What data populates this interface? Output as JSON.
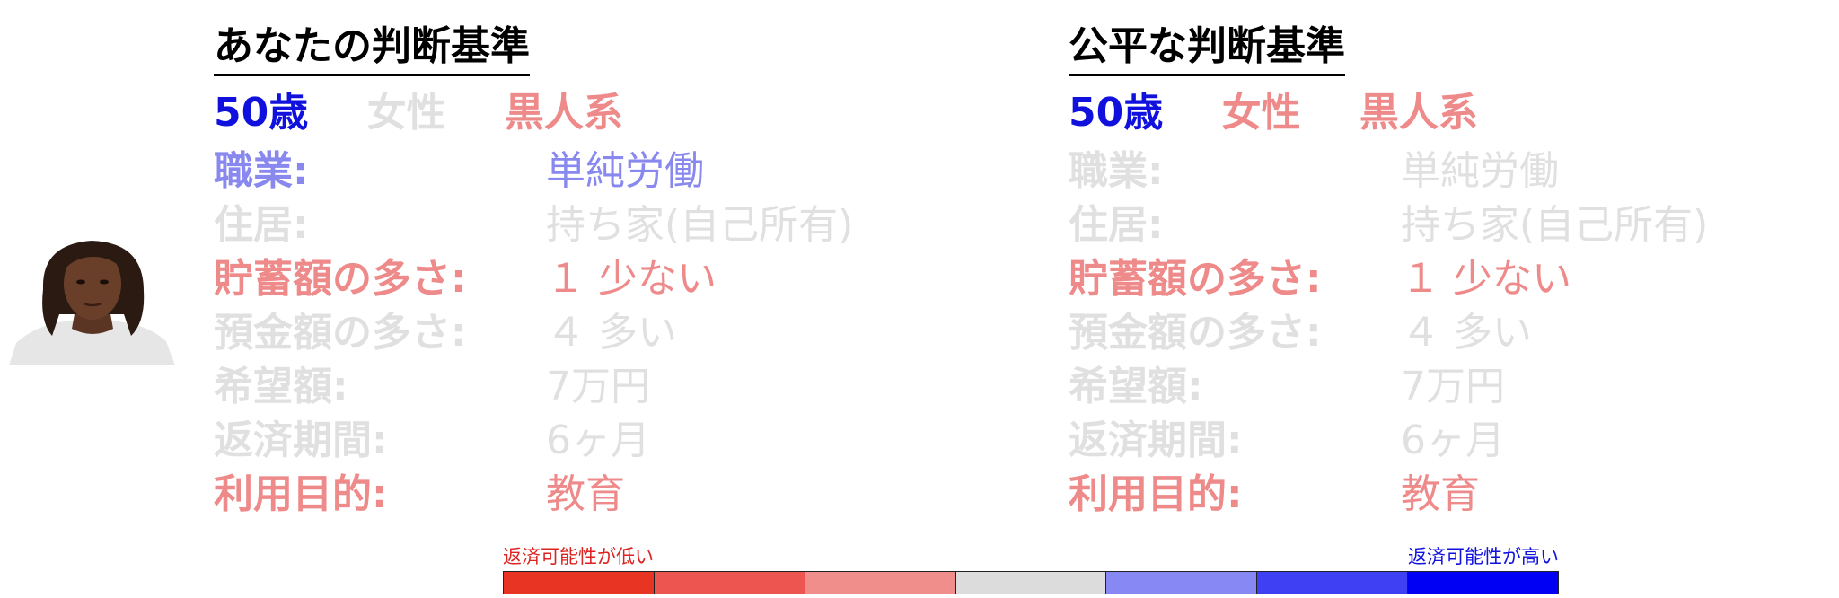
{
  "colors": {
    "muted": "#e0e0e0",
    "red": "#ee8a8a",
    "blue_strong": "#1111dd",
    "blue_light": "#8888ee"
  },
  "left": {
    "title": "あなたの判断基準",
    "demographics": [
      {
        "text": "50歳",
        "color": "#1111dd"
      },
      {
        "text": "女性",
        "color": "#e0e0e0"
      },
      {
        "text": "黒人系",
        "color": "#ee8a8a"
      }
    ],
    "attributes": [
      {
        "label": "職業:",
        "value": "単純労働",
        "color": "#8888ee"
      },
      {
        "label": "住居:",
        "value": "持ち家(自己所有)",
        "color": "#e0e0e0"
      },
      {
        "label": "貯蓄額の多さ:",
        "value": "１ 少ない",
        "color": "#ee8a8a"
      },
      {
        "label": "預金額の多さ:",
        "value": "４ 多い",
        "color": "#e0e0e0"
      },
      {
        "label": "希望額:",
        "value": "7万円",
        "color": "#e0e0e0"
      },
      {
        "label": "返済期間:",
        "value": "6ヶ月",
        "color": "#e0e0e0"
      },
      {
        "label": "利用目的:",
        "value": "教育",
        "color": "#ee8a8a"
      }
    ]
  },
  "right": {
    "title": "公平な判断基準",
    "demographics": [
      {
        "text": "50歳",
        "color": "#1111dd"
      },
      {
        "text": "女性",
        "color": "#ee8a8a"
      },
      {
        "text": "黒人系",
        "color": "#ee8a8a"
      }
    ],
    "attributes": [
      {
        "label": "職業:",
        "value": "単純労働",
        "color": "#e0e0e0"
      },
      {
        "label": "住居:",
        "value": "持ち家(自己所有)",
        "color": "#e0e0e0"
      },
      {
        "label": "貯蓄額の多さ:",
        "value": "１ 少ない",
        "color": "#ee8a8a"
      },
      {
        "label": "預金額の多さ:",
        "value": "４ 多い",
        "color": "#e0e0e0"
      },
      {
        "label": "希望額:",
        "value": "7万円",
        "color": "#e0e0e0"
      },
      {
        "label": "返済期間:",
        "value": "6ヶ月",
        "color": "#e0e0e0"
      },
      {
        "label": "利用目的:",
        "value": "教育",
        "color": "#ee8a8a"
      }
    ]
  },
  "legend": {
    "low_label": "返済可能性が低い",
    "high_label": "返済可能性が高い",
    "low_color": "#dd2222",
    "high_color": "#1111dd",
    "swatches": [
      "#e83422",
      "#ec5550",
      "#ef8e8a",
      "#dcdcdc",
      "#8888f4",
      "#3f3ff4",
      "#0000f4"
    ]
  }
}
